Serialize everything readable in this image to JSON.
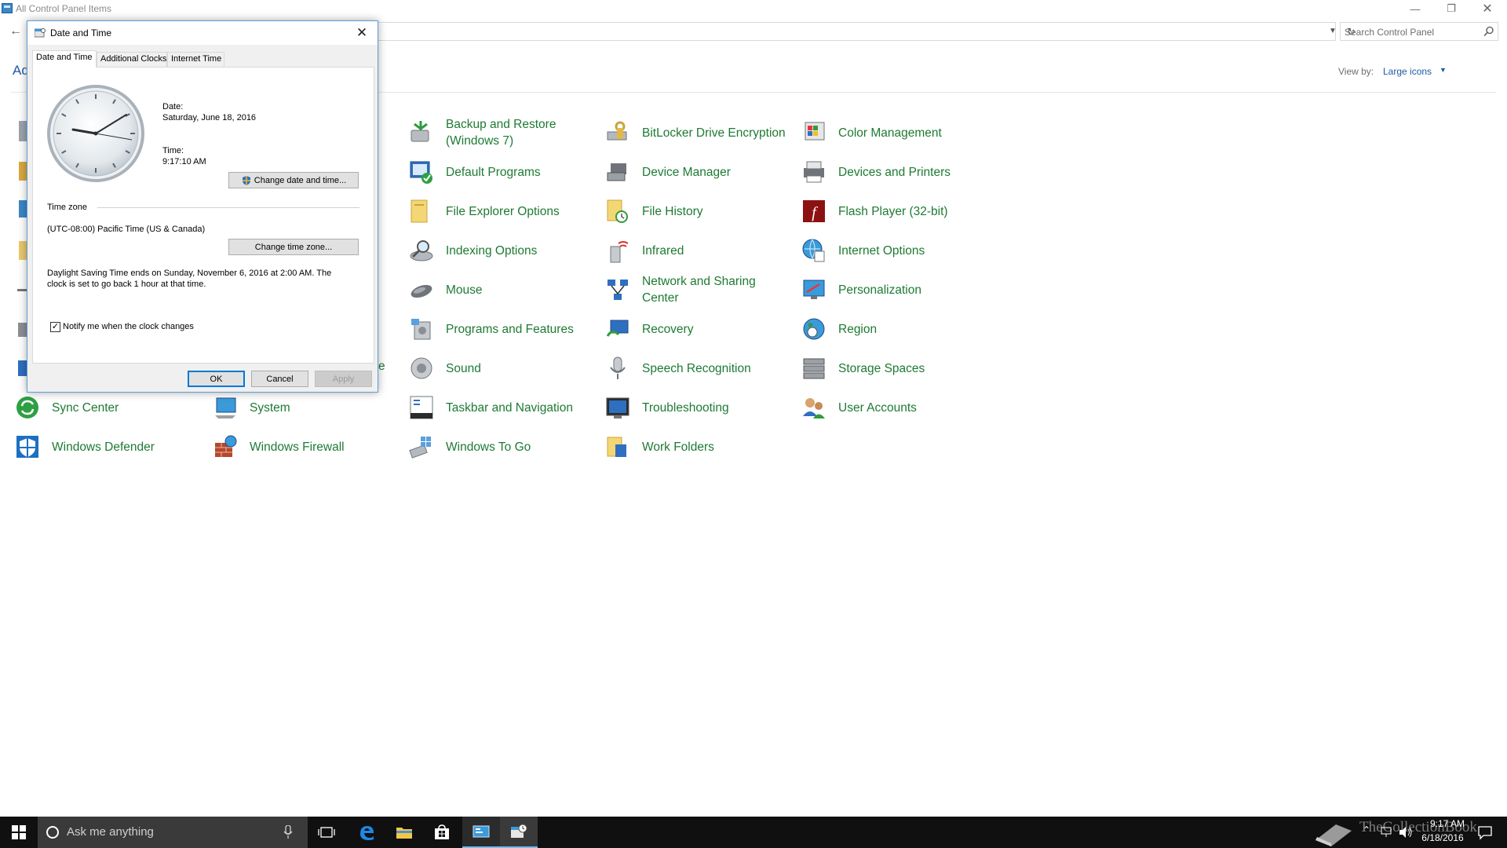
{
  "window": {
    "title": "All Control Panel Items",
    "heading_partial": "Ad",
    "search_placeholder": "Search Control Panel",
    "view_by_label": "View by:",
    "view_by_value": "Large icons"
  },
  "items": [
    {
      "label": "Backup and Restore (Windows 7)",
      "icon": "backup-icon"
    },
    {
      "label": "BitLocker Drive Encryption",
      "icon": "bitlocker-icon"
    },
    {
      "label": "Color Management",
      "icon": "color-management-icon"
    },
    {
      "label": "Default Programs",
      "icon": "default-programs-icon"
    },
    {
      "label": "Device Manager",
      "icon": "device-manager-icon"
    },
    {
      "label": "Devices and Printers",
      "icon": "printer-icon"
    },
    {
      "label": "File Explorer Options",
      "icon": "folder-options-icon"
    },
    {
      "label": "File History",
      "icon": "file-history-icon"
    },
    {
      "label": "Flash Player (32-bit)",
      "icon": "flash-icon"
    },
    {
      "label": "Indexing Options",
      "icon": "indexing-icon"
    },
    {
      "label": "Infrared",
      "icon": "infrared-icon"
    },
    {
      "label": "Internet Options",
      "icon": "internet-options-icon"
    },
    {
      "label": "Mouse",
      "icon": "mouse-icon"
    },
    {
      "label": "Network and Sharing Center",
      "icon": "network-icon"
    },
    {
      "label": "Personalization",
      "icon": "personalization-icon"
    },
    {
      "label": "Programs and Features",
      "icon": "programs-icon"
    },
    {
      "label": "Recovery",
      "icon": "recovery-icon"
    },
    {
      "label": "Region",
      "icon": "region-icon"
    },
    {
      "label": "Sound",
      "icon": "sound-icon"
    },
    {
      "label": "Speech Recognition",
      "icon": "microphone-icon"
    },
    {
      "label": "Storage Spaces",
      "icon": "storage-icon"
    },
    {
      "label": "Sync Center",
      "icon": "sync-icon"
    },
    {
      "label": "System",
      "icon": "system-icon"
    },
    {
      "label": "Taskbar and Navigation",
      "icon": "taskbar-icon"
    },
    {
      "label": "Troubleshooting",
      "icon": "troubleshooting-icon"
    },
    {
      "label": "User Accounts",
      "icon": "user-accounts-icon"
    },
    {
      "label": "Windows Defender",
      "icon": "defender-icon"
    },
    {
      "label": "Windows Firewall",
      "icon": "firewall-icon"
    },
    {
      "label": "Windows To Go",
      "icon": "windows-to-go-icon"
    },
    {
      "label": "Work Folders",
      "icon": "work-folders-icon"
    },
    {
      "label": "e",
      "icon": "partial-label"
    }
  ],
  "dialog": {
    "title": "Date and Time",
    "tabs": [
      "Date and Time",
      "Additional Clocks",
      "Internet Time"
    ],
    "date_label": "Date:",
    "date_value": "Saturday, June 18, 2016",
    "time_label": "Time:",
    "time_value": "9:17:10 AM",
    "change_datetime_button": "Change date and time...",
    "timezone_heading": "Time zone",
    "timezone_value": "(UTC-08:00) Pacific Time (US & Canada)",
    "change_timezone_button": "Change time zone...",
    "dst_line1": "Daylight Saving Time ends on Sunday, November 6, 2016 at 2:00 AM. The",
    "dst_line2": "clock is set to go back 1 hour at that time.",
    "notify_checkbox_label": "Notify me when the clock changes",
    "notify_checked": "✓",
    "ok_button": "OK",
    "cancel_button": "Cancel",
    "apply_button": "Apply"
  },
  "taskbar": {
    "search_placeholder": "Ask me anything",
    "watermark": "TheCollectionBook",
    "clock_time": "9:17 AM",
    "clock_date": "6/18/2016"
  },
  "colors": {
    "link_green": "#1e7a33",
    "link_blue": "#1e5aa8",
    "accent": "#0078d7",
    "taskbar": "#101010"
  }
}
